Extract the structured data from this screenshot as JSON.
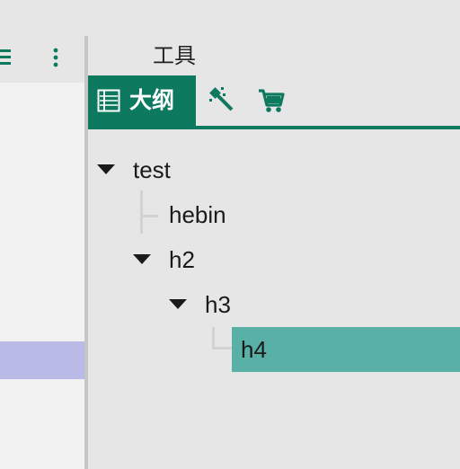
{
  "left_toolbar": {
    "list_icon": "list-icon",
    "more_icon": "kebab-icon"
  },
  "panel": {
    "title": "工具"
  },
  "tabs": {
    "outline_label": "大纲",
    "outline_icon": "outline-icon",
    "magic_icon": "magic-wand-icon",
    "cart_icon": "cart-icon"
  },
  "colors": {
    "accent": "#0d7a5f",
    "selected_node": "#58b0a6",
    "left_selected": "#b9bbe6"
  },
  "tree": {
    "root": {
      "label": "test",
      "expanded": true
    },
    "hebin": {
      "label": "hebin"
    },
    "h2": {
      "label": "h2",
      "expanded": true
    },
    "h3": {
      "label": "h3",
      "expanded": true
    },
    "h4": {
      "label": "h4",
      "selected": true
    }
  }
}
